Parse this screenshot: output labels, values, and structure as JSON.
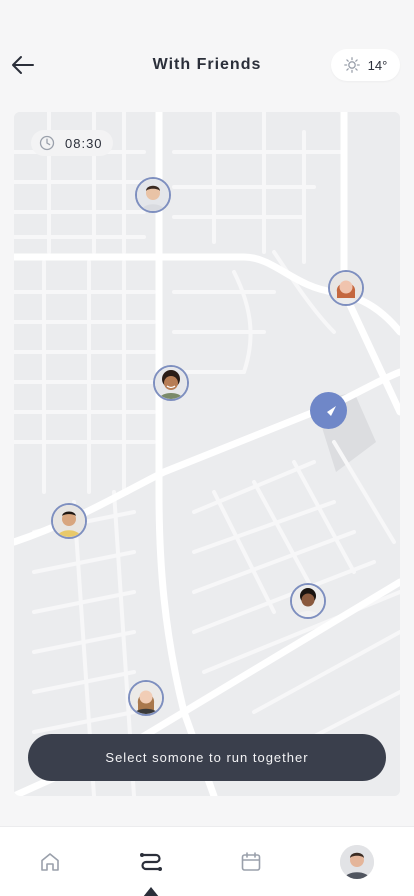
{
  "header": {
    "back_icon": "arrow-left-icon",
    "title": "With Friends",
    "weather": {
      "icon": "sun-icon",
      "temperature": "14°"
    }
  },
  "map": {
    "time": "08:30",
    "time_icon": "clock-icon",
    "friends": [
      {
        "id": "friend-1",
        "skin": "#e9c3a6",
        "hair": "#3a2a22"
      },
      {
        "id": "friend-2",
        "skin": "#f0c4ae",
        "hair": "#c4673e"
      },
      {
        "id": "friend-3",
        "skin": "#b77d55",
        "hair": "#2a1c16"
      },
      {
        "id": "friend-4",
        "skin": "#d8a67f",
        "hair": "#1f1712"
      },
      {
        "id": "friend-5",
        "skin": "#8a5a3e",
        "hair": "#1a1410"
      },
      {
        "id": "friend-6",
        "skin": "#f1cdb6",
        "hair": "#a9784d"
      }
    ],
    "my_location_icon": "navigation-arrow-icon"
  },
  "cta": {
    "label": "Select somone to run together"
  },
  "nav": {
    "items": [
      {
        "icon": "home-icon"
      },
      {
        "icon": "route-icon",
        "active": true
      },
      {
        "icon": "calendar-icon"
      },
      {
        "icon": "profile-avatar"
      }
    ]
  },
  "colors": {
    "accent": "#6f87c8",
    "marker_border": "#7e8fbf",
    "button": "#3a3f4c",
    "map_bg": "#ebecee",
    "road": "#ffffff"
  }
}
